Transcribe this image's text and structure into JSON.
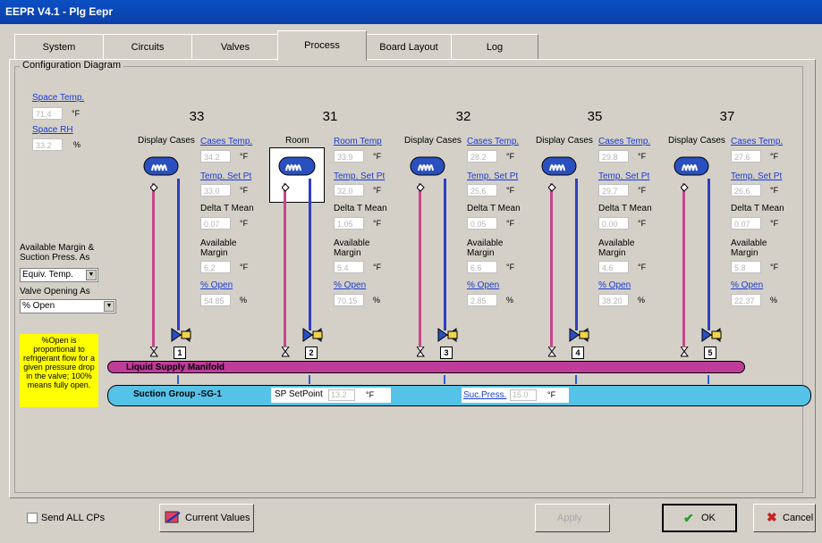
{
  "window": {
    "title": "EEPR V4.1 - Plg Eepr"
  },
  "tabs": [
    "System",
    "Circuits",
    "Valves",
    "Process",
    "Board Layout",
    "Log"
  ],
  "group_label": "Configuration Diagram",
  "space": {
    "temp_label": "Space Temp.",
    "temp_value": "71.4",
    "temp_unit": "°F",
    "rh_label": "Space RH",
    "rh_value": "33.2",
    "rh_unit": "%"
  },
  "controls": {
    "margin_label": "Available Margin & Suction Press. As",
    "margin_select": "Equiv. Temp.",
    "opening_label": "Valve Opening As",
    "opening_select": "% Open",
    "note": "%Open is proportional to refrigerant flow for a given pressure drop in the valve; 100% means fully open."
  },
  "circuits": [
    {
      "number": "33",
      "name": "Display Cases",
      "temp_label": "Cases Temp.",
      "temp": "34.2",
      "setpt_label": "Temp. Set Pt",
      "setpt": "33.0",
      "delta_label": "Delta T Mean",
      "delta": "0.07",
      "margin_label": "Available Margin",
      "margin": "6.2",
      "open_label": "% Open",
      "open": "54.85",
      "unit_num": "1"
    },
    {
      "number": "31",
      "name": "Room",
      "temp_label": "Room Temp",
      "temp": "33.9",
      "setpt_label": "Temp. Set Pt",
      "setpt": "32.0",
      "delta_label": "Delta T Mean",
      "delta": "1.05",
      "margin_label": "Available Margin",
      "margin": "5.4",
      "open_label": "% Open",
      "open": "70.15",
      "unit_num": "2"
    },
    {
      "number": "32",
      "name": "Display Cases",
      "temp_label": "Cases Temp.",
      "temp": "28.2",
      "setpt_label": "Temp. Set Pt",
      "setpt": "25.6",
      "delta_label": "Delta T Mean",
      "delta": "0.05",
      "margin_label": "Available Margin",
      "margin": "6.6",
      "open_label": "% Open",
      "open": "2.85",
      "unit_num": "3"
    },
    {
      "number": "35",
      "name": "Display Cases",
      "temp_label": "Cases Temp.",
      "temp": "29.8",
      "setpt_label": "Temp. Set Pt",
      "setpt": "29.7",
      "delta_label": "Delta T Mean",
      "delta": "0.00",
      "margin_label": "Available Margin",
      "margin": "4.6",
      "open_label": "% Open",
      "open": "38.20",
      "unit_num": "4"
    },
    {
      "number": "37",
      "name": "Display Cases",
      "temp_label": "Cases Temp.",
      "temp": "27.6",
      "setpt_label": "Temp. Set Pt",
      "setpt": "26.6",
      "delta_label": "Delta T Mean",
      "delta": "0.07",
      "margin_label": "Available Margin",
      "margin": "5.8",
      "open_label": "% Open",
      "open": "22.37",
      "unit_num": "5"
    }
  ],
  "units": {
    "f": "°F",
    "pct": "%"
  },
  "manifold": {
    "label": "Liquid Supply Manifold"
  },
  "suction": {
    "label": "Suction Group -SG-1",
    "sp_label": "SP SetPoint",
    "sp_value": "13.2",
    "sp_unit": "°F",
    "press_label": "Suc.Press.",
    "press_value": "15.0",
    "press_unit": "°F"
  },
  "footer": {
    "send_all": "Send ALL CPs",
    "current_values": "Current Values",
    "apply": "Apply",
    "ok": "OK",
    "cancel": "Cancel"
  }
}
